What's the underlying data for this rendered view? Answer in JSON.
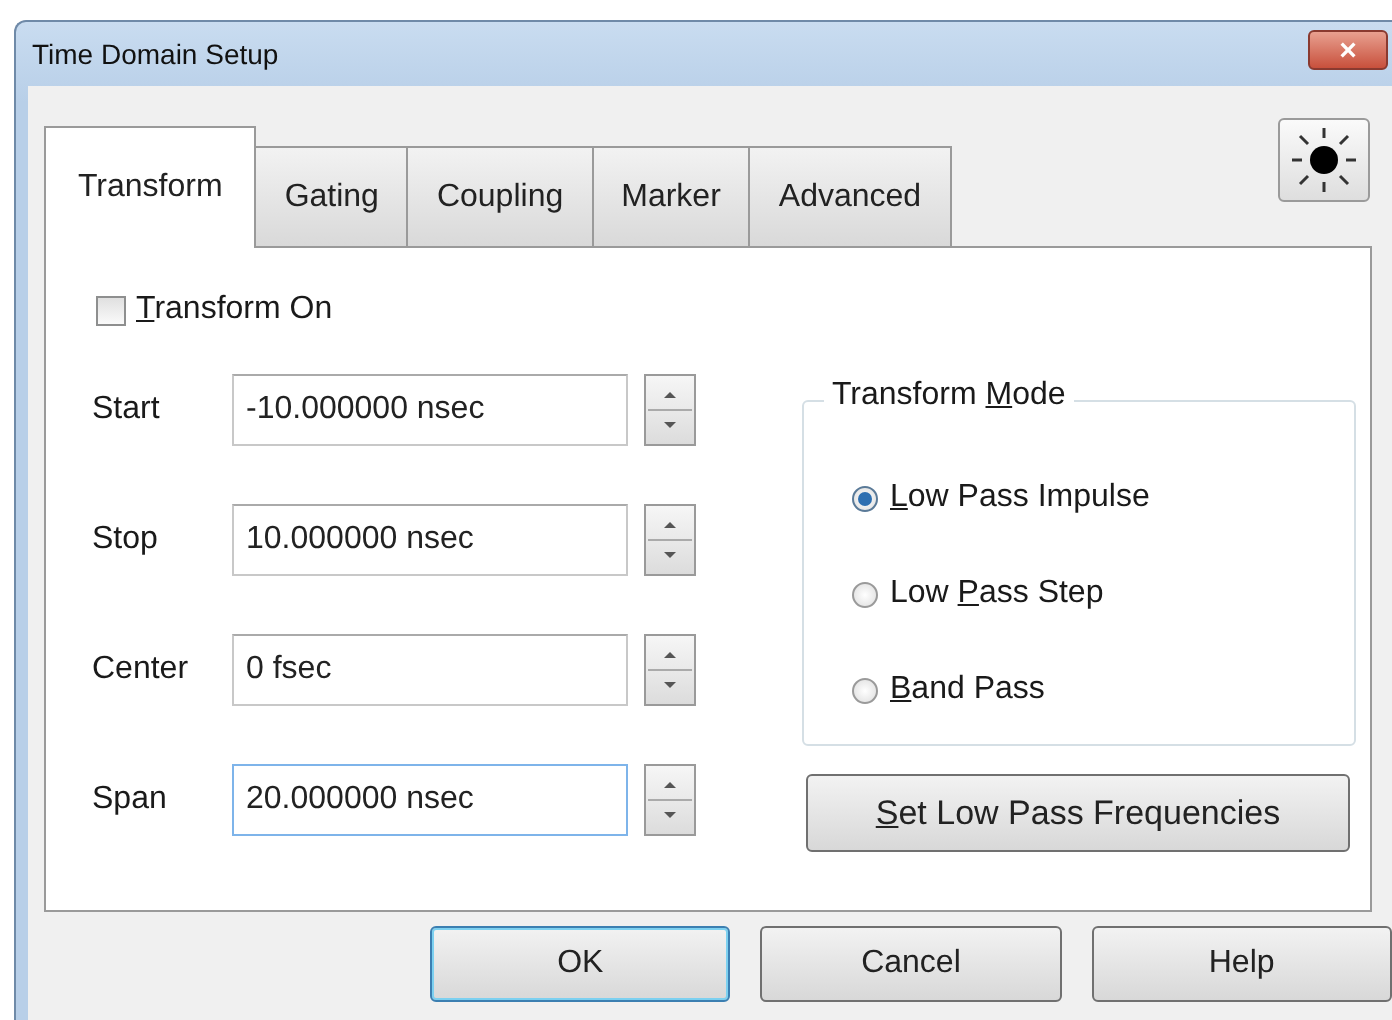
{
  "window": {
    "title": "Time Domain Setup",
    "close": "×"
  },
  "tabs": [
    {
      "label": "Transform",
      "selected": true
    },
    {
      "label": "Gating",
      "selected": false
    },
    {
      "label": "Coupling",
      "selected": false
    },
    {
      "label": "Marker",
      "selected": false
    },
    {
      "label": "Advanced",
      "selected": false
    }
  ],
  "transform_on": {
    "label": {
      "access_key": "T",
      "after": "ransform On"
    },
    "checked": false
  },
  "fields": [
    {
      "label": "Start",
      "value": "-10.000000 nsec",
      "focused": false
    },
    {
      "label": "Stop",
      "value": "10.000000 nsec",
      "focused": false
    },
    {
      "label": "Center",
      "value": "0 fsec",
      "focused": false
    },
    {
      "label": "Span",
      "value": "20.000000 nsec",
      "focused": true
    }
  ],
  "transform_mode": {
    "title": {
      "before": "Transform ",
      "access_key": "M",
      "after": "ode"
    },
    "options": [
      {
        "label": {
          "access_key": "L",
          "after": "ow Pass Impulse"
        },
        "selected": true
      },
      {
        "label": {
          "before": "Low ",
          "access_key": "P",
          "after": "ass Step"
        },
        "selected": false
      },
      {
        "label": {
          "access_key": "B",
          "after": "and Pass"
        },
        "selected": false
      }
    ]
  },
  "set_frequencies_button": {
    "label": {
      "access_key": "S",
      "after": "et Low Pass Frequencies"
    }
  },
  "buttons": [
    {
      "label": "OK",
      "default": true
    },
    {
      "label": "Cancel",
      "default": false
    },
    {
      "label": "Help",
      "default": false
    }
  ]
}
